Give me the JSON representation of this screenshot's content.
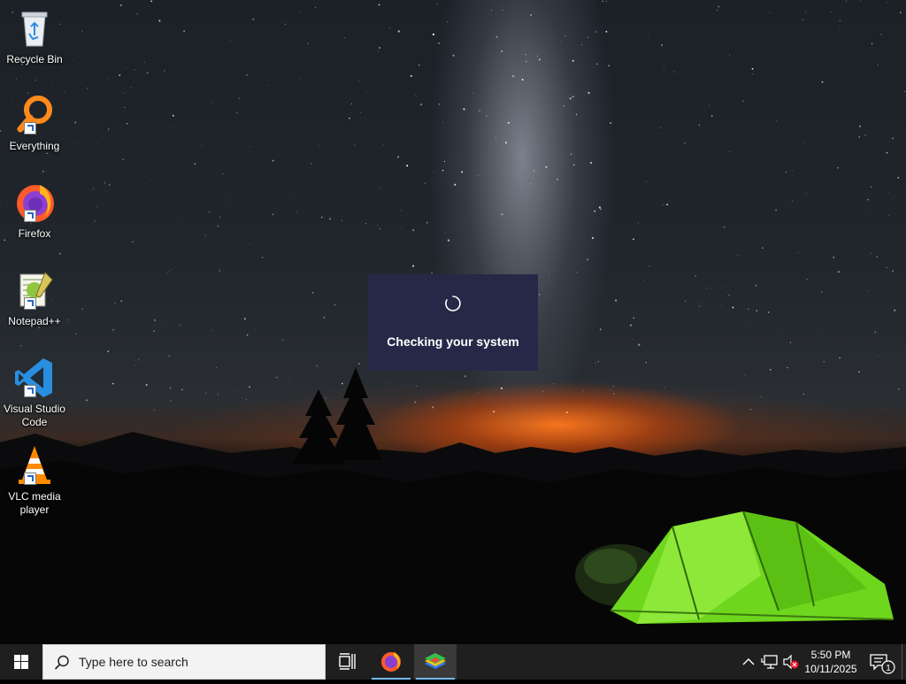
{
  "desktop_icons": [
    {
      "label": "Recycle Bin",
      "icon": "recycle-bin-icon"
    },
    {
      "label": "Everything",
      "icon": "everything-search-icon"
    },
    {
      "label": "Firefox",
      "icon": "firefox-icon"
    },
    {
      "label": "Notepad++",
      "icon": "notepad-plus-plus-icon"
    },
    {
      "label": "Visual Studio Code",
      "icon": "vscode-icon"
    },
    {
      "label": "VLC media player",
      "icon": "vlc-icon"
    }
  ],
  "dialog": {
    "message": "Checking your system",
    "color": "#252947"
  },
  "taskbar": {
    "search_placeholder": "Type here to search",
    "pinned_apps": [
      "firefox-icon",
      "bluestacks-icon"
    ],
    "active_app": "bluestacks-icon",
    "clock": {
      "time": "5:50 PM",
      "date": "10/11/2025"
    },
    "notification_count": "1",
    "accent_color": "#76b9ed"
  }
}
